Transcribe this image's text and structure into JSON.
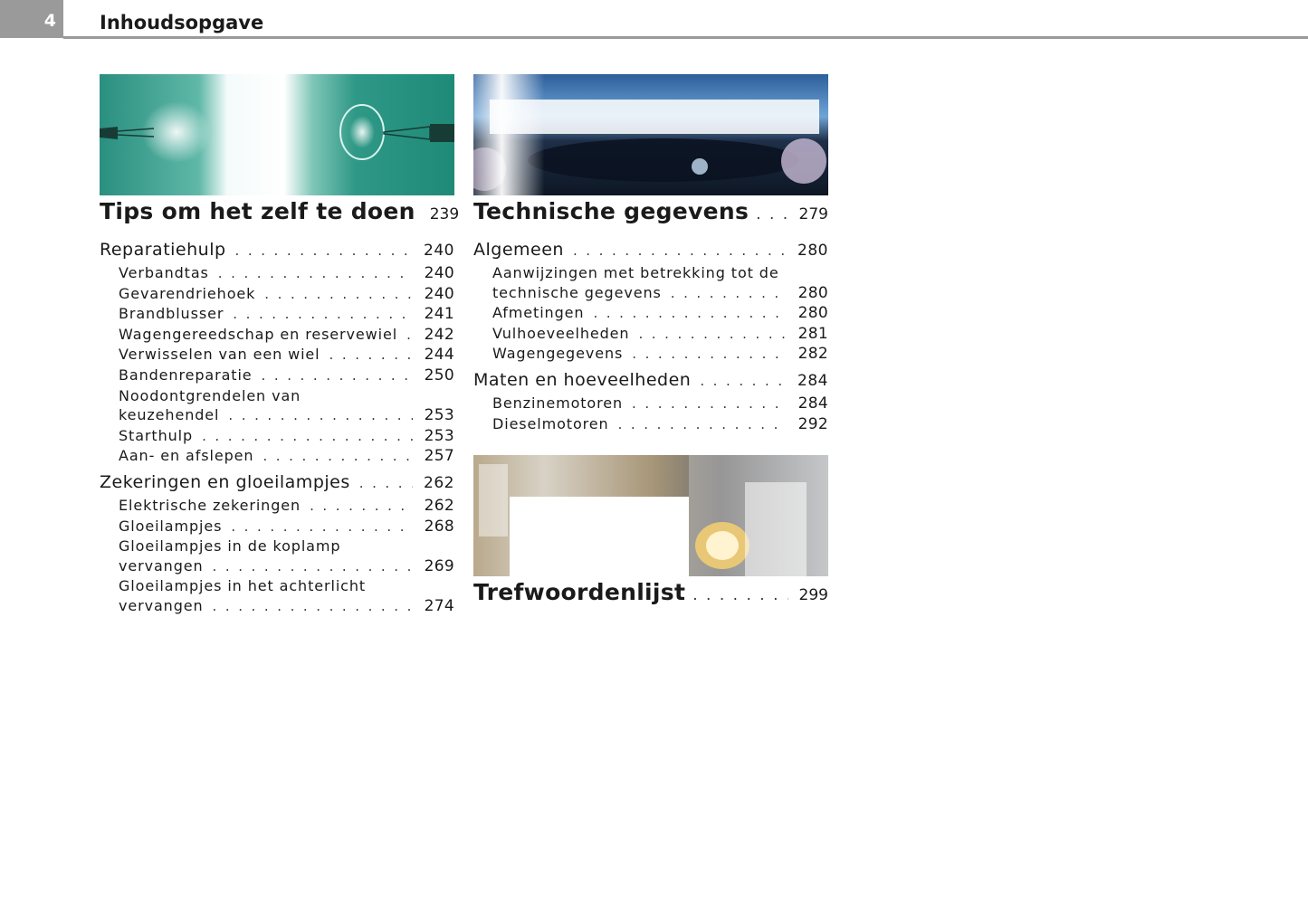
{
  "header": {
    "page_number": "4",
    "title": "Inhoudsopgave"
  },
  "dots": ". . . . . . . . . . . . . . . . . . . . . . . . . . . . . . . . . . . . . . . . . . .",
  "sections": [
    {
      "title": "Tips om het zelf te doen",
      "page": "239",
      "entries": [
        {
          "label": "Reparatiehulp",
          "page": "240"
        },
        {
          "label": "Verbandtas",
          "page": "240"
        },
        {
          "label": "Gevarendriehoek",
          "page": "240"
        },
        {
          "label": "Brandblusser",
          "page": "241"
        },
        {
          "label": "Wagengereedschap en reservewiel",
          "page": "242"
        },
        {
          "label": "Verwisselen van een wiel",
          "page": "244"
        },
        {
          "label": "Bandenreparatie",
          "page": "250"
        },
        {
          "label": "Noodontgrendelen van",
          "page": ""
        },
        {
          "label": "keuzehendel",
          "page": "253"
        },
        {
          "label": "Starthulp",
          "page": "253"
        },
        {
          "label": "Aan- en afslepen",
          "page": "257"
        },
        {
          "label": "Zekeringen en gloeilampjes",
          "page": "262"
        },
        {
          "label": "Elektrische zekeringen",
          "page": "262"
        },
        {
          "label": "Gloeilampjes",
          "page": "268"
        },
        {
          "label": "Gloeilampjes in de koplamp",
          "page": ""
        },
        {
          "label": "vervangen",
          "page": "269"
        },
        {
          "label": "Gloeilampjes in het achterlicht",
          "page": ""
        },
        {
          "label": "vervangen",
          "page": "274"
        }
      ]
    },
    {
      "title": "Technische gegevens",
      "page": "279",
      "entries": [
        {
          "label": "Algemeen",
          "page": "280"
        },
        {
          "label": "Aanwijzingen met betrekking tot de",
          "page": ""
        },
        {
          "label": "technische gegevens",
          "page": "280"
        },
        {
          "label": "Afmetingen",
          "page": "280"
        },
        {
          "label": "Vulhoeveelheden",
          "page": "281"
        },
        {
          "label": "Wagengegevens",
          "page": "282"
        },
        {
          "label": "Maten en hoeveelheden",
          "page": "284"
        },
        {
          "label": "Benzinemotoren",
          "page": "284"
        },
        {
          "label": "Dieselmotoren",
          "page": "292"
        }
      ]
    },
    {
      "title": "Trefwoordenlijst",
      "page": "299",
      "entries": []
    }
  ]
}
